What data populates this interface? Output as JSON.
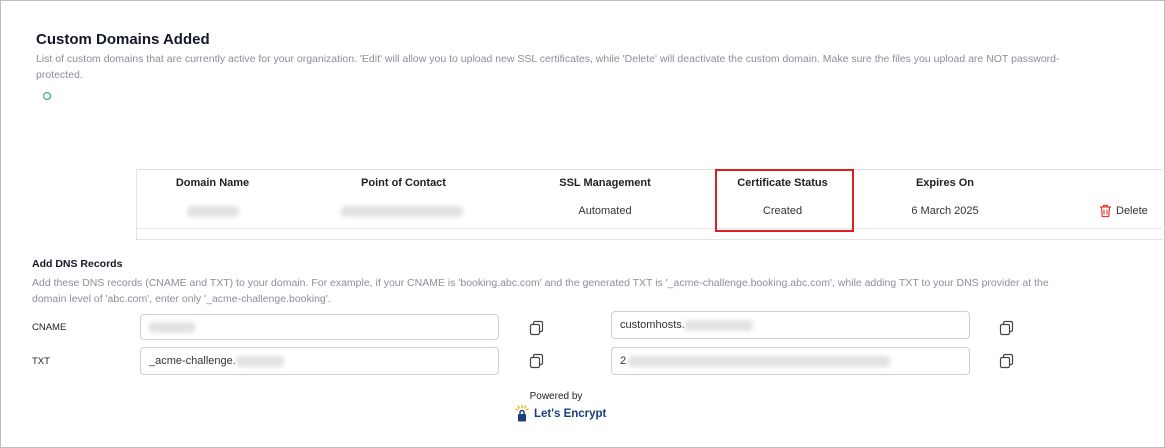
{
  "header": {
    "title": "Custom Domains Added",
    "description": "List of custom domains that are currently active for your organization. 'Edit' will allow you to upload new SSL certificates, while 'Delete' will deactivate the custom domain. Make sure the files you upload are NOT password-protected."
  },
  "table": {
    "columns": [
      "Domain Name",
      "Point of Contact",
      "SSL Management",
      "Certificate Status",
      "Expires On"
    ],
    "rows": [
      {
        "ssl_management": "Automated",
        "certificate_status": "Created",
        "expires_on": "6 March 2025",
        "delete_label": "Delete"
      }
    ]
  },
  "dns": {
    "title": "Add DNS Records",
    "description": "Add these DNS records (CNAME and TXT) to your domain. For example, if your CNAME is 'booking.abc.com' and the generated TXT is '_acme-challenge.booking.abc.com', while adding TXT to your DNS provider at the domain level of 'abc.com', enter only '_acme-challenge.booking'.",
    "cname_label": "CNAME",
    "txt_label": "TXT",
    "cname_value_prefix": "customhosts.",
    "txt_name_prefix": "_acme-challenge.",
    "txt_value_prefix": "2"
  },
  "footer": {
    "powered_by": "Powered by",
    "brand": "Let's Encrypt"
  },
  "colors": {
    "highlight": "#e01e1e",
    "delete_icon": "#e53935",
    "brand_blue": "#1b3f7a",
    "brand_yellow": "#f5b400",
    "status_ring": "#22a05a"
  }
}
